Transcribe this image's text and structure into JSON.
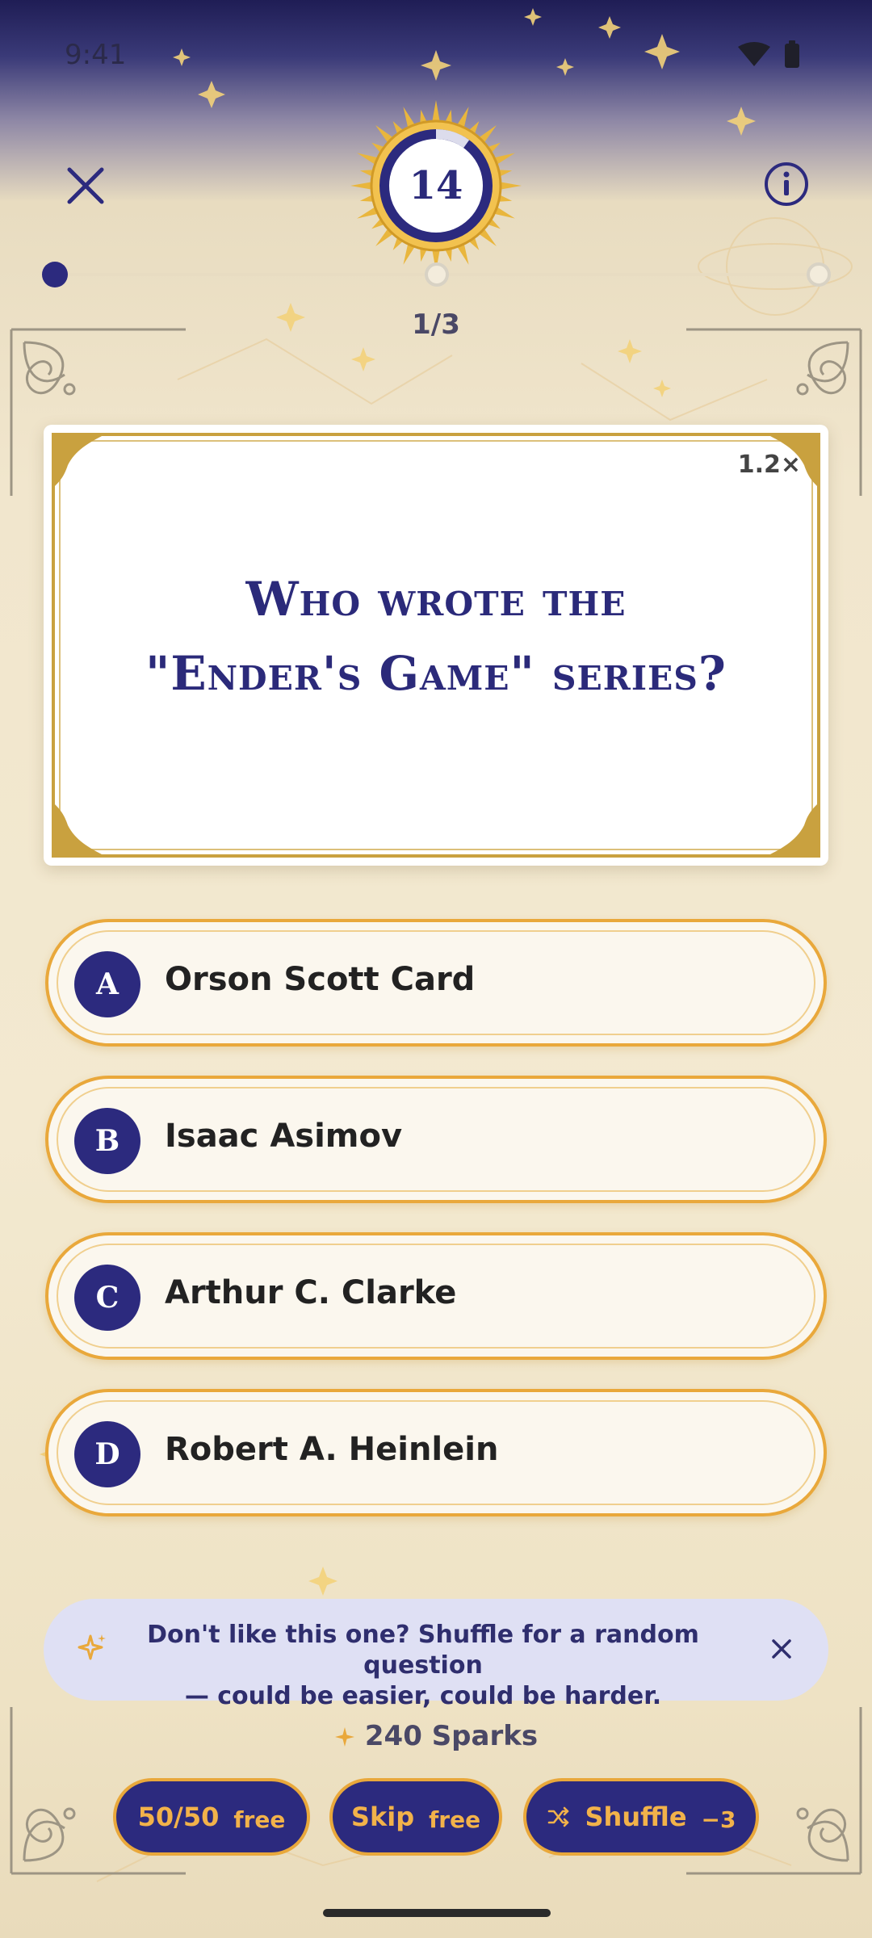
{
  "status_bar": {
    "time": "9:41",
    "icons": [
      "wifi-icon",
      "battery-icon"
    ]
  },
  "header": {
    "timer_value": "14",
    "timer_fraction": 0.9,
    "progress_label": "1/3",
    "progress_current": 1,
    "progress_total": 3
  },
  "question": {
    "multiplier": "1.2×",
    "line1": "Who wrote the",
    "line2": "\"Ender's Game\" series?"
  },
  "answers": [
    {
      "letter": "A",
      "text": "Orson Scott Card"
    },
    {
      "letter": "B",
      "text": "Isaac Asimov"
    },
    {
      "letter": "C",
      "text": "Arthur C. Clarke"
    },
    {
      "letter": "D",
      "text": "Robert A. Heinlein"
    }
  ],
  "hint": {
    "line1": "Don't like this one? Shuffle for a random question",
    "line2": "— could be easier, could be harder."
  },
  "sparks": "240 Sparks",
  "lifelines": [
    {
      "label": "50/50",
      "cost": "free"
    },
    {
      "label": "Skip",
      "cost": "free"
    },
    {
      "label": "Shuffle",
      "cost": "−3"
    }
  ],
  "colors": {
    "navy": "#2c2a7e",
    "gold": "#e9a83b",
    "cream": "#fbf7ee"
  }
}
